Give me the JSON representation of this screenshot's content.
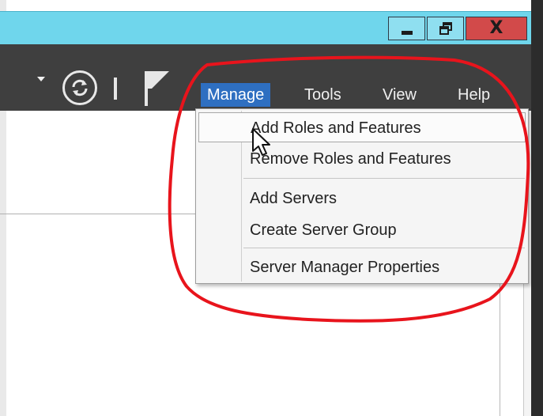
{
  "window": {
    "controls": {
      "minimize_icon": "minimize-icon",
      "maximize_icon": "restore-icon",
      "close_label": "X"
    }
  },
  "toolbar": {
    "icons": [
      "dropdown-caret-icon",
      "refresh-icon",
      "flag-icon"
    ]
  },
  "menu_bar": {
    "items": [
      {
        "label": "Manage",
        "active": true
      },
      {
        "label": "Tools"
      },
      {
        "label": "View"
      },
      {
        "label": "Help"
      }
    ]
  },
  "manage_menu": {
    "groups": [
      [
        "Add Roles and Features",
        "Remove Roles and Features"
      ],
      [
        "Add Servers",
        "Create Server Group"
      ],
      [
        "Server Manager Properties"
      ]
    ],
    "hovered": "Add Roles and Features"
  },
  "colors": {
    "titlebar": "#6fd6ec",
    "toolbar": "#3f3f3f",
    "menu_active": "#2e6fc1",
    "close_button": "#d24a4a",
    "annotation": "#e8141c"
  }
}
